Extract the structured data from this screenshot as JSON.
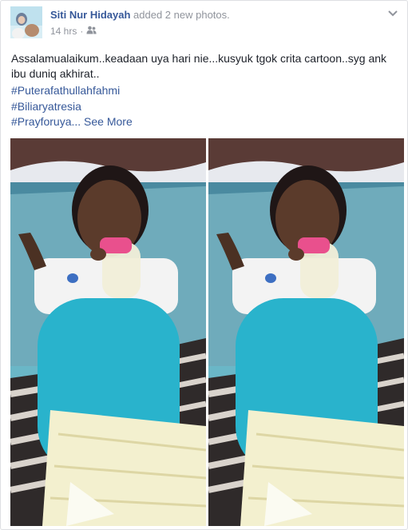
{
  "post": {
    "author": "Siti Nur Hidayah",
    "action": "added 2 new photos.",
    "time": "14 hrs",
    "separator": "·",
    "privacy_icon": "friends-icon",
    "menu_icon": "chevron-down-icon",
    "message": "Assalamualaikum..keadaan uya hari nie...kusyuk tgok crita cartoon..syg ank ibu duniq akhirat..",
    "hashtags": [
      "#Puterafathullahfahmi",
      "#Biliaryatresia",
      "#Prayforuya..."
    ],
    "see_more": "See More",
    "photos": [
      {
        "caption": ""
      },
      {
        "caption": ""
      }
    ],
    "colors": {
      "link": "#365899",
      "meta": "#90949c",
      "text": "#1d2129"
    }
  }
}
